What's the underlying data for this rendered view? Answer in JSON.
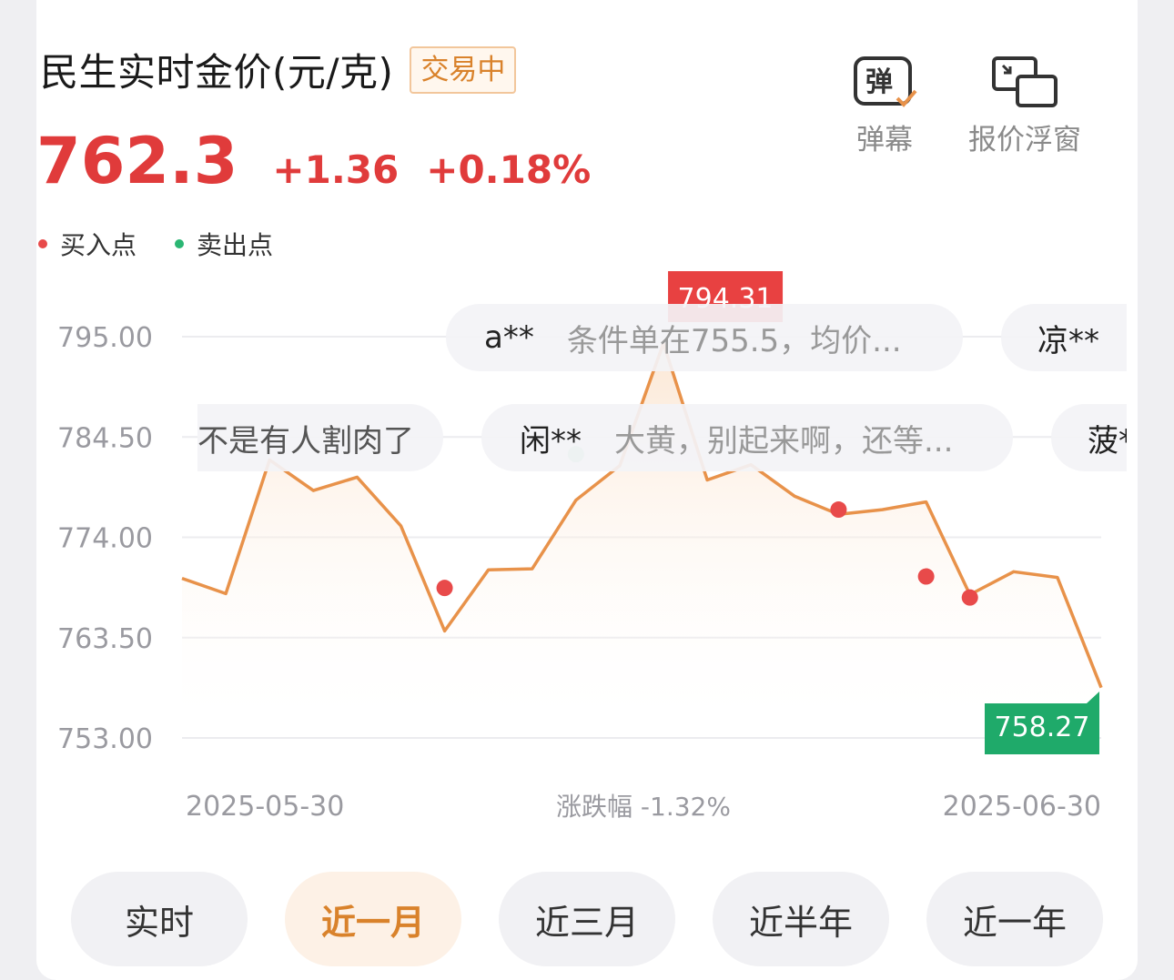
{
  "header": {
    "title": "民生实时金价(元/克)",
    "status_badge": "交易中",
    "price": "762.3",
    "change": "+1.36",
    "change_pct": "+0.18%"
  },
  "legend": {
    "buy": "买入点",
    "sell": "卖出点"
  },
  "tools": {
    "danmaku_label": "弹幕",
    "float_window_label": "报价浮窗",
    "danmaku_icon_char": "弹"
  },
  "danmaku": [
    {
      "user": "a**",
      "message": "条件单在755.5，均价..."
    },
    {
      "user": "凉**",
      "message": ""
    },
    {
      "user": "",
      "message": "不是有人割肉了"
    },
    {
      "user": "闲**",
      "message": "大黄，别起来啊，还等..."
    },
    {
      "user": "菠*",
      "message": ""
    }
  ],
  "chart_data": {
    "type": "line",
    "y_ticks": [
      "795.00",
      "784.50",
      "774.00",
      "763.50",
      "753.00"
    ],
    "ylim": [
      753.0,
      795.0
    ],
    "x_labels": {
      "start": "2025-05-30",
      "end": "2025-06-30"
    },
    "range_label": "涨跌幅 -1.32%",
    "series": [
      {
        "values": [
          769.7,
          768.1,
          782.1,
          778.9,
          780.3,
          775.2,
          764.2,
          770.6,
          770.7,
          777.9,
          781.5,
          794.31,
          780.0,
          781.6,
          778.3,
          776.4,
          776.9,
          777.7,
          768.0,
          770.4,
          769.8,
          758.27
        ]
      }
    ],
    "max_label": "794.31",
    "min_label": "758.27",
    "buy_points": [
      {
        "index": 6,
        "value": 768.7
      },
      {
        "index": 15,
        "value": 776.9
      },
      {
        "index": 17,
        "value": 769.9
      },
      {
        "index": 18,
        "value": 767.7
      }
    ],
    "sell_points": [
      {
        "index": 9,
        "value": 782.7
      }
    ],
    "colors": {
      "line": "#e8924a",
      "buy": "#e84a4a",
      "sell": "#2bb673",
      "max_bg": "#e84141",
      "min_bg": "#1faa6a"
    }
  },
  "range_tabs": [
    {
      "label": "实时",
      "active": false
    },
    {
      "label": "近一月",
      "active": true
    },
    {
      "label": "近三月",
      "active": false
    },
    {
      "label": "近半年",
      "active": false
    },
    {
      "label": "近一年",
      "active": false
    }
  ]
}
